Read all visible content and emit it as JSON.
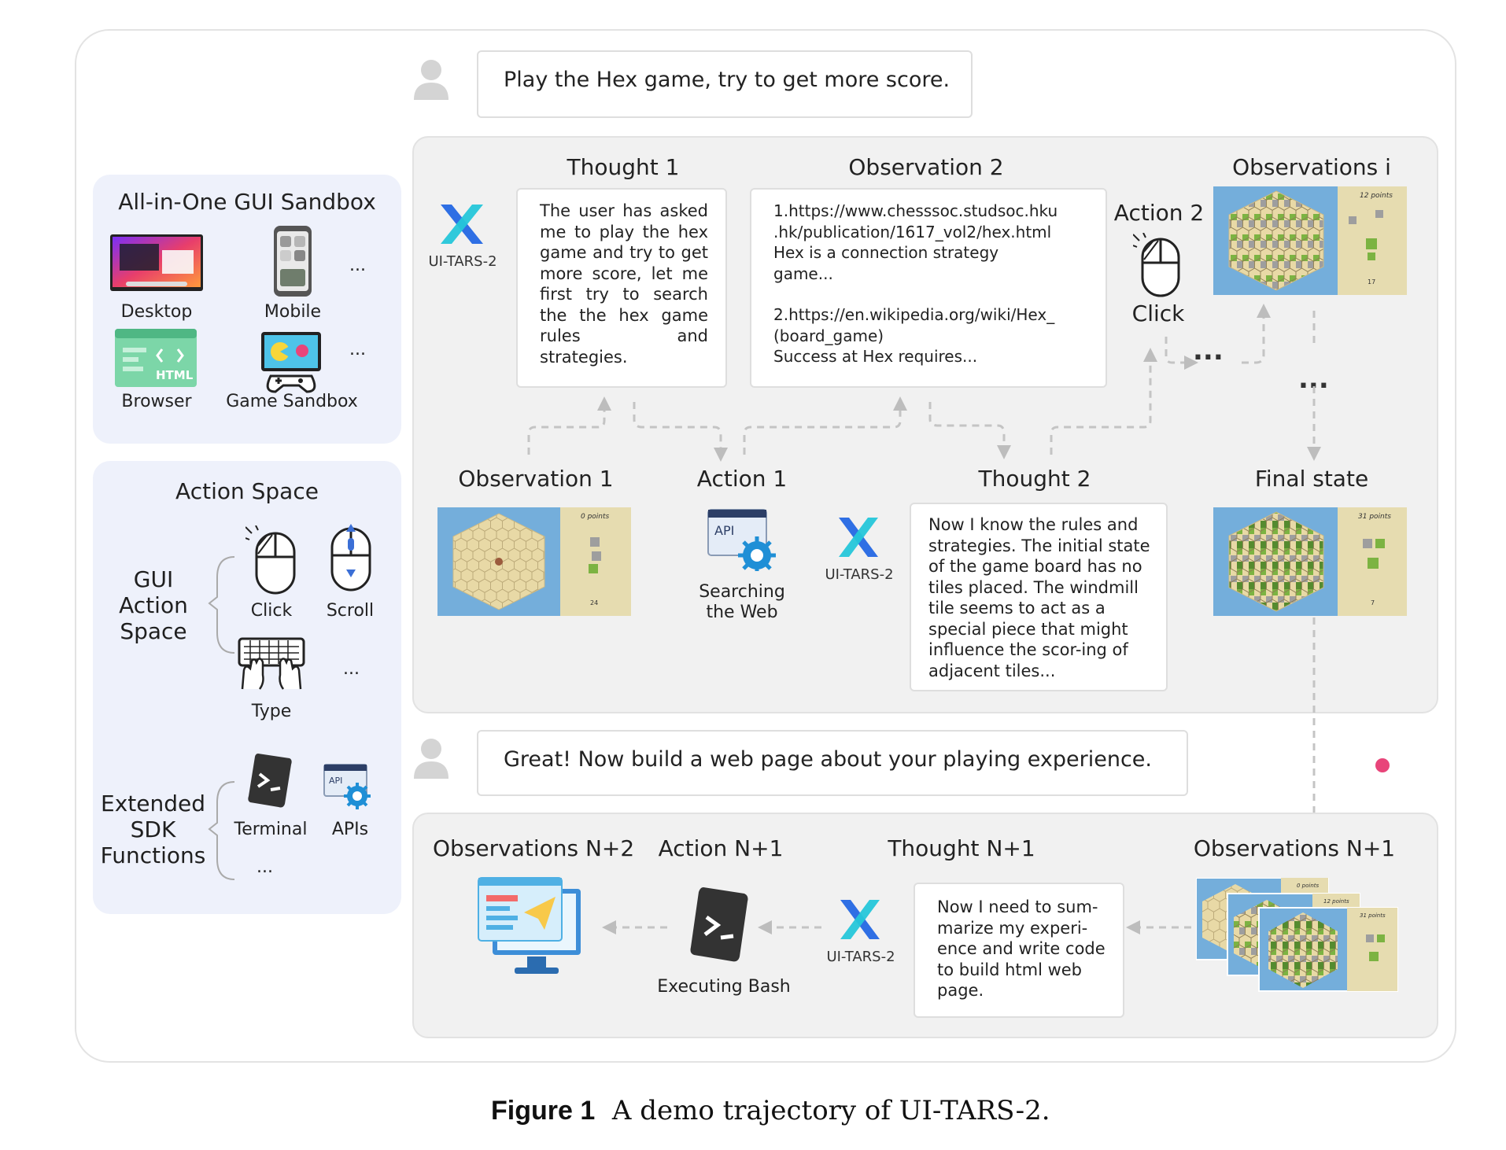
{
  "prompts": {
    "first": "Play the Hex game, try to get more score.",
    "second": "Great! Now build a web page about your playing experience."
  },
  "sandbox": {
    "title": "All-in-One GUI Sandbox",
    "items": [
      "Desktop",
      "Mobile",
      "Browser",
      "Game Sandbox"
    ],
    "ellipsis": "...",
    "browser_icon_text": "HTML"
  },
  "action_space": {
    "title": "Action Space",
    "gui_label": "GUI\nAction\nSpace",
    "gui_actions": [
      "Click",
      "Scroll",
      "Type"
    ],
    "sdk_label": "Extended\nSDK\nFunctions",
    "sdk_actions": [
      "Terminal",
      "APIs"
    ],
    "api_icon_text": "API",
    "ellipsis": "..."
  },
  "agent_name": "UI-TARS-2",
  "top_section": {
    "thought1": {
      "heading": "Thought 1",
      "text": "The user has asked me to play the hex game and try to get more score, let me first try to search the the hex game rules and strategies."
    },
    "observation2": {
      "heading": "Observation 2",
      "lines": [
        "1.https://www.chesssoc.studsoc.hku",
        ".hk/publication/1617_vol2/hex.html",
        "Hex is a connection strategy",
        "game...",
        "",
        "2.https://en.wikipedia.org/wiki/Hex_",
        "(board_game)",
        "Success at Hex requires..."
      ]
    },
    "action2": {
      "heading": "Action 2",
      "label": "Click"
    },
    "observations_i": {
      "heading": "Observations i",
      "points": "12 points",
      "counter": "17"
    },
    "observation1": {
      "heading": "Observation 1",
      "points": "0 points",
      "counter": "24"
    },
    "action1": {
      "heading": "Action 1",
      "label": "Searching\nthe Web",
      "api_text": "API"
    },
    "thought2": {
      "heading": "Thought 2",
      "text": "Now I know the rules and strategies. The initial state of the game board has no tiles placed. The windmill tile seems to act as a special piece that might influence the scor-ing of adjacent tiles..."
    },
    "final_state": {
      "heading": "Final state",
      "points": "31 points",
      "counter": "7"
    },
    "ellipsis": "..."
  },
  "bottom_section": {
    "obs_n2": {
      "heading": "Observations N+2"
    },
    "action_n1": {
      "heading": "Action N+1",
      "label": "Executing Bash"
    },
    "thought_n1": {
      "heading": "Thought N+1",
      "text": "Now I need to sum-marize my experi-ence and write code to build html web page."
    },
    "obs_n1": {
      "heading": "Observations N+1",
      "points": [
        "0 points",
        "12 points",
        "31 points"
      ]
    }
  },
  "caption": {
    "label": "Figure 1",
    "text": "A demo trajectory of UI-TARS-2."
  },
  "colors": {
    "panel_bg": "#f1f1f1",
    "left_panel_bg": "#eef1fb",
    "logo_blue": "#2f6fe4",
    "logo_teal": "#25c6d9",
    "gear_blue": "#1f8fd6",
    "arrow_gray": "#bdbdbd",
    "pink_dot": "#e8457a",
    "board_blue": "#74aedb",
    "board_tan": "#e6dcb0"
  }
}
